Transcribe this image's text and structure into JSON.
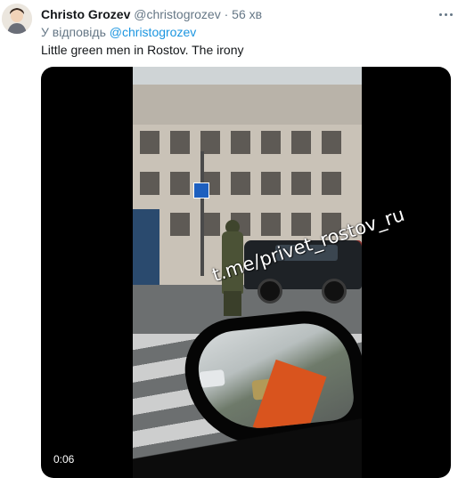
{
  "tweet": {
    "author_name": "Christo Grozev",
    "author_handle": "@christogrozev",
    "separator": "·",
    "time": "56 хв",
    "reply_prefix": "У відповідь",
    "reply_to": "@christogrozev",
    "text": "Little green men in Rostov. The irony"
  },
  "media": {
    "watermark": "t.me/privet_rostov_ru",
    "duration": "0:06"
  },
  "icons": {
    "more": "more-dots-icon",
    "avatar": "avatar-image"
  },
  "colors": {
    "name": "#14171a",
    "muted": "#657786",
    "link": "#1b95e0",
    "media_bg": "#000000"
  }
}
